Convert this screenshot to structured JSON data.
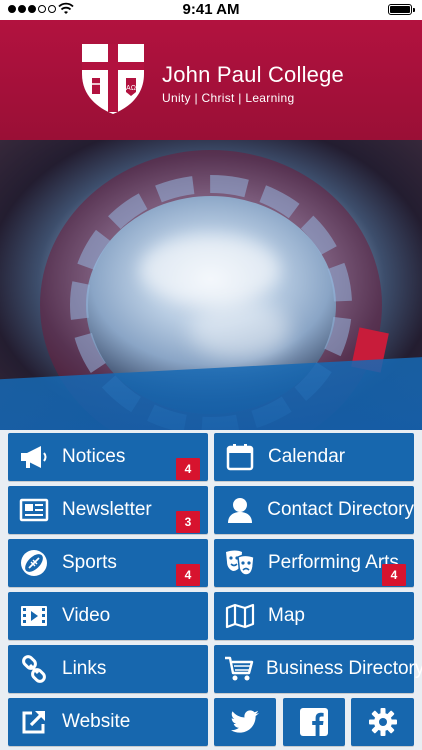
{
  "status_bar": {
    "time": "9:41 AM"
  },
  "header": {
    "school_name": "John Paul College",
    "motto": "Unity  |  Christ  |  Learning",
    "brand_color": "#b2123f"
  },
  "tiles": {
    "notices": {
      "label": "Notices",
      "badge": "4",
      "icon": "megaphone-icon"
    },
    "calendar": {
      "label": "Calendar",
      "icon": "calendar-icon"
    },
    "newsletter": {
      "label": "Newsletter",
      "badge": "3",
      "icon": "newspaper-icon"
    },
    "contact_directory": {
      "label": "Contact Directory",
      "icon": "person-icon"
    },
    "sports": {
      "label": "Sports",
      "badge": "4",
      "icon": "football-icon"
    },
    "performing_arts": {
      "label": "Performing Arts",
      "badge": "4",
      "icon": "theatre-masks-icon"
    },
    "video": {
      "label": "Video",
      "icon": "video-icon"
    },
    "map": {
      "label": "Map",
      "icon": "map-icon"
    },
    "links": {
      "label": "Links",
      "icon": "link-icon"
    },
    "business_directory": {
      "label": "Business Directory",
      "icon": "cart-icon"
    },
    "website": {
      "label": "Website",
      "icon": "external-link-icon"
    }
  },
  "social": {
    "twitter": {
      "icon": "twitter-icon"
    },
    "facebook": {
      "icon": "facebook-icon"
    },
    "settings": {
      "icon": "gear-icon"
    }
  },
  "colors": {
    "tile": "#1767ae",
    "badge": "#d7132e",
    "background": "#e9eef3"
  }
}
